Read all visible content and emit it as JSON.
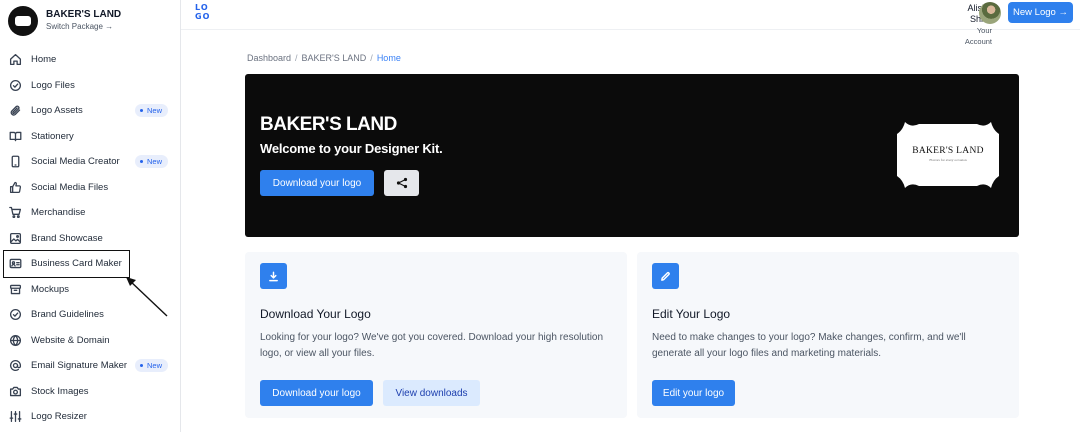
{
  "brand": {
    "name": "BAKER'S LAND",
    "switch": "Switch Package →"
  },
  "nav": [
    {
      "label": "Home",
      "icon": "home-icon"
    },
    {
      "label": "Logo Files",
      "icon": "check-circle-icon"
    },
    {
      "label": "Logo Assets",
      "icon": "paperclip-icon",
      "badge": "New"
    },
    {
      "label": "Stationery",
      "icon": "book-icon"
    },
    {
      "label": "Social Media Creator",
      "icon": "phone-icon",
      "badge": "New"
    },
    {
      "label": "Social Media Files",
      "icon": "thumbs-up-icon"
    },
    {
      "label": "Merchandise",
      "icon": "cart-icon"
    },
    {
      "label": "Brand Showcase",
      "icon": "image-icon"
    },
    {
      "label": "Business Card Maker",
      "icon": "id-card-icon"
    },
    {
      "label": "Mockups",
      "icon": "box-icon"
    },
    {
      "label": "Brand Guidelines",
      "icon": "check-badge-icon"
    },
    {
      "label": "Website & Domain",
      "icon": "globe-icon"
    },
    {
      "label": "Email Signature Maker",
      "icon": "at-sign-icon",
      "badge": "New"
    },
    {
      "label": "Stock Images",
      "icon": "camera-icon"
    },
    {
      "label": "Logo Resizer",
      "icon": "sliders-icon"
    }
  ],
  "header": {
    "logo": "LOGO",
    "user_name": "Alisha Shibli",
    "user_sub": "Your Account",
    "new_logo": "New Logo →"
  },
  "breadcrumb": {
    "items": [
      "Dashboard",
      "BAKER'S LAND",
      "Home"
    ],
    "sep": "/"
  },
  "hero": {
    "title": "BAKER'S LAND",
    "subtitle": "Welcome to your Designer Kit.",
    "download": "Download your logo",
    "logo_text": "BAKER'S LAND",
    "logo_tagline": "Flavors for every occasion"
  },
  "cards": {
    "download": {
      "title": "Download Your Logo",
      "desc": "Looking for your logo? We've got you covered. Download your high resolution logo, or view all your files.",
      "primary": "Download your logo",
      "secondary": "View downloads"
    },
    "edit": {
      "title": "Edit Your Logo",
      "desc": "Need to make changes to your logo? Make changes, confirm, and we'll generate all your logo files and marketing materials.",
      "primary": "Edit your logo"
    }
  },
  "colors": {
    "accent": "#2f80ed",
    "hero_bg": "#0b0b0b",
    "card_bg": "#f6f8fb"
  }
}
